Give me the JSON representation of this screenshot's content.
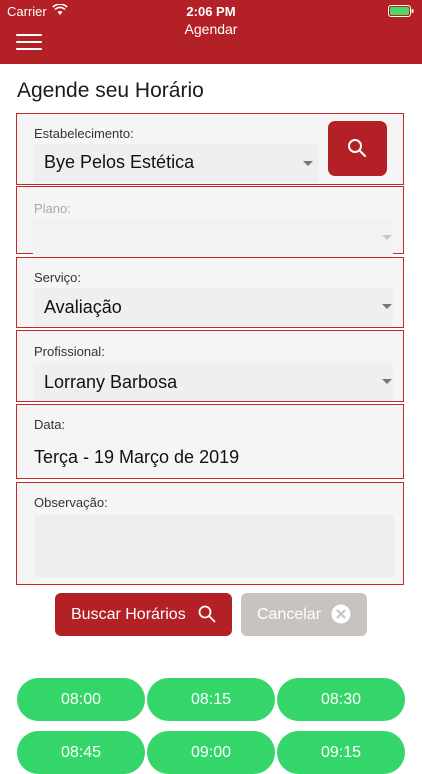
{
  "status_bar": {
    "carrier": "Carrier",
    "time": "2:06 PM"
  },
  "nav": {
    "title": "Agendar"
  },
  "page": {
    "title": "Agende seu Horário"
  },
  "form": {
    "establishment": {
      "label": "Estabelecimento:",
      "value": "Bye Pelos Estética"
    },
    "plan": {
      "label": "Plano:",
      "value": ""
    },
    "service": {
      "label": "Serviço:",
      "value": "Avaliação"
    },
    "professional": {
      "label": "Profissional:",
      "value": "Lorrany Barbosa"
    },
    "date": {
      "label": "Data:",
      "value": "Terça - 19 Março de 2019"
    },
    "observation": {
      "label": "Observação:",
      "value": ""
    }
  },
  "actions": {
    "search_label": "Buscar Horários",
    "cancel_label": "Cancelar"
  },
  "time_slots": [
    "08:00",
    "08:15",
    "08:30",
    "08:45",
    "09:00",
    "09:15"
  ],
  "colors": {
    "primary": "#b32025",
    "slot_green": "#34d66a",
    "cancel_gray": "#c7c3bf"
  }
}
